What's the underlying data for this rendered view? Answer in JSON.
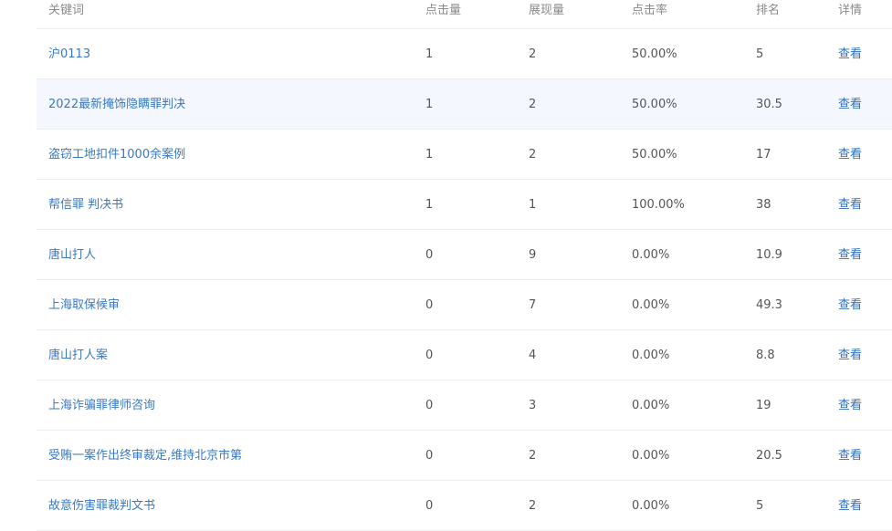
{
  "table": {
    "headers": {
      "keyword": "关键词",
      "clicks": "点击量",
      "impressions": "展现量",
      "ctr": "点击率",
      "rank": "排名",
      "detail": "详情"
    },
    "rows": [
      {
        "keyword": "沪0113",
        "clicks": "1",
        "impressions": "2",
        "ctr": "50.00%",
        "rank": "5",
        "detail": "查看"
      },
      {
        "keyword": "2022最新掩饰隐瞒罪判决",
        "clicks": "1",
        "impressions": "2",
        "ctr": "50.00%",
        "rank": "30.5",
        "detail": "查看"
      },
      {
        "keyword": "盗窃工地扣件1000余案例",
        "clicks": "1",
        "impressions": "2",
        "ctr": "50.00%",
        "rank": "17",
        "detail": "查看"
      },
      {
        "keyword": "帮信罪 判决书",
        "clicks": "1",
        "impressions": "1",
        "ctr": "100.00%",
        "rank": "38",
        "detail": "查看"
      },
      {
        "keyword": "唐山打人",
        "clicks": "0",
        "impressions": "9",
        "ctr": "0.00%",
        "rank": "10.9",
        "detail": "查看"
      },
      {
        "keyword": "上海取保候审",
        "clicks": "0",
        "impressions": "7",
        "ctr": "0.00%",
        "rank": "49.3",
        "detail": "查看"
      },
      {
        "keyword": "唐山打人案",
        "clicks": "0",
        "impressions": "4",
        "ctr": "0.00%",
        "rank": "8.8",
        "detail": "查看"
      },
      {
        "keyword": "上海诈骗罪律师咨询",
        "clicks": "0",
        "impressions": "3",
        "ctr": "0.00%",
        "rank": "19",
        "detail": "查看"
      },
      {
        "keyword": "受贿一案作出终审裁定,维持北京市第",
        "clicks": "0",
        "impressions": "2",
        "ctr": "0.00%",
        "rank": "20.5",
        "detail": "查看"
      },
      {
        "keyword": "故意伤害罪裁判文书",
        "clicks": "0",
        "impressions": "2",
        "ctr": "0.00%",
        "rank": "5",
        "detail": "查看"
      }
    ]
  }
}
